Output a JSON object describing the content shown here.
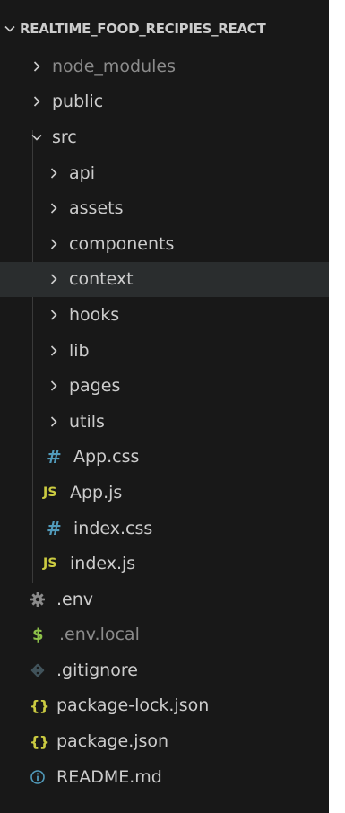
{
  "explorer": {
    "root_label": "REALTIME_FOOD_RECIPIES_REACT",
    "items": [
      {
        "label": "node_modules",
        "type": "folder",
        "expanded": false,
        "dimmed": true
      },
      {
        "label": "public",
        "type": "folder",
        "expanded": false
      },
      {
        "label": "src",
        "type": "folder",
        "expanded": true
      },
      {
        "label": "api",
        "type": "folder",
        "expanded": false
      },
      {
        "label": "assets",
        "type": "folder",
        "expanded": false
      },
      {
        "label": "components",
        "type": "folder",
        "expanded": false
      },
      {
        "label": "context",
        "type": "folder",
        "expanded": false,
        "selected": true
      },
      {
        "label": "hooks",
        "type": "folder",
        "expanded": false
      },
      {
        "label": "lib",
        "type": "folder",
        "expanded": false
      },
      {
        "label": "pages",
        "type": "folder",
        "expanded": false
      },
      {
        "label": "utils",
        "type": "folder",
        "expanded": false
      },
      {
        "label": "App.css",
        "type": "file",
        "icon": "hash-icon",
        "icon_text": "#"
      },
      {
        "label": "App.js",
        "type": "file",
        "icon": "js-icon",
        "icon_text": "JS"
      },
      {
        "label": "index.css",
        "type": "file",
        "icon": "hash-icon",
        "icon_text": "#"
      },
      {
        "label": "index.js",
        "type": "file",
        "icon": "js-icon",
        "icon_text": "JS"
      },
      {
        "label": ".env",
        "type": "file",
        "icon": "gear-icon"
      },
      {
        "label": ".env.local",
        "type": "file",
        "icon": "dollar-icon",
        "icon_text": "$",
        "dimmed": true
      },
      {
        "label": ".gitignore",
        "type": "file",
        "icon": "git-icon"
      },
      {
        "label": "package-lock.json",
        "type": "file",
        "icon": "braces-icon",
        "icon_text": "{}"
      },
      {
        "label": "package.json",
        "type": "file",
        "icon": "braces-icon",
        "icon_text": "{}"
      },
      {
        "label": "README.md",
        "type": "file",
        "icon": "info-icon"
      }
    ]
  },
  "colors": {
    "background": "#181818",
    "text": "#cccccc",
    "dimmed_text": "#8b8b8b",
    "selected_row": "#2a2d2e",
    "css_icon": "#519aba",
    "js_icon": "#cbcb41",
    "env_local_icon": "#8dc149",
    "json_icon": "#cbcb41"
  }
}
